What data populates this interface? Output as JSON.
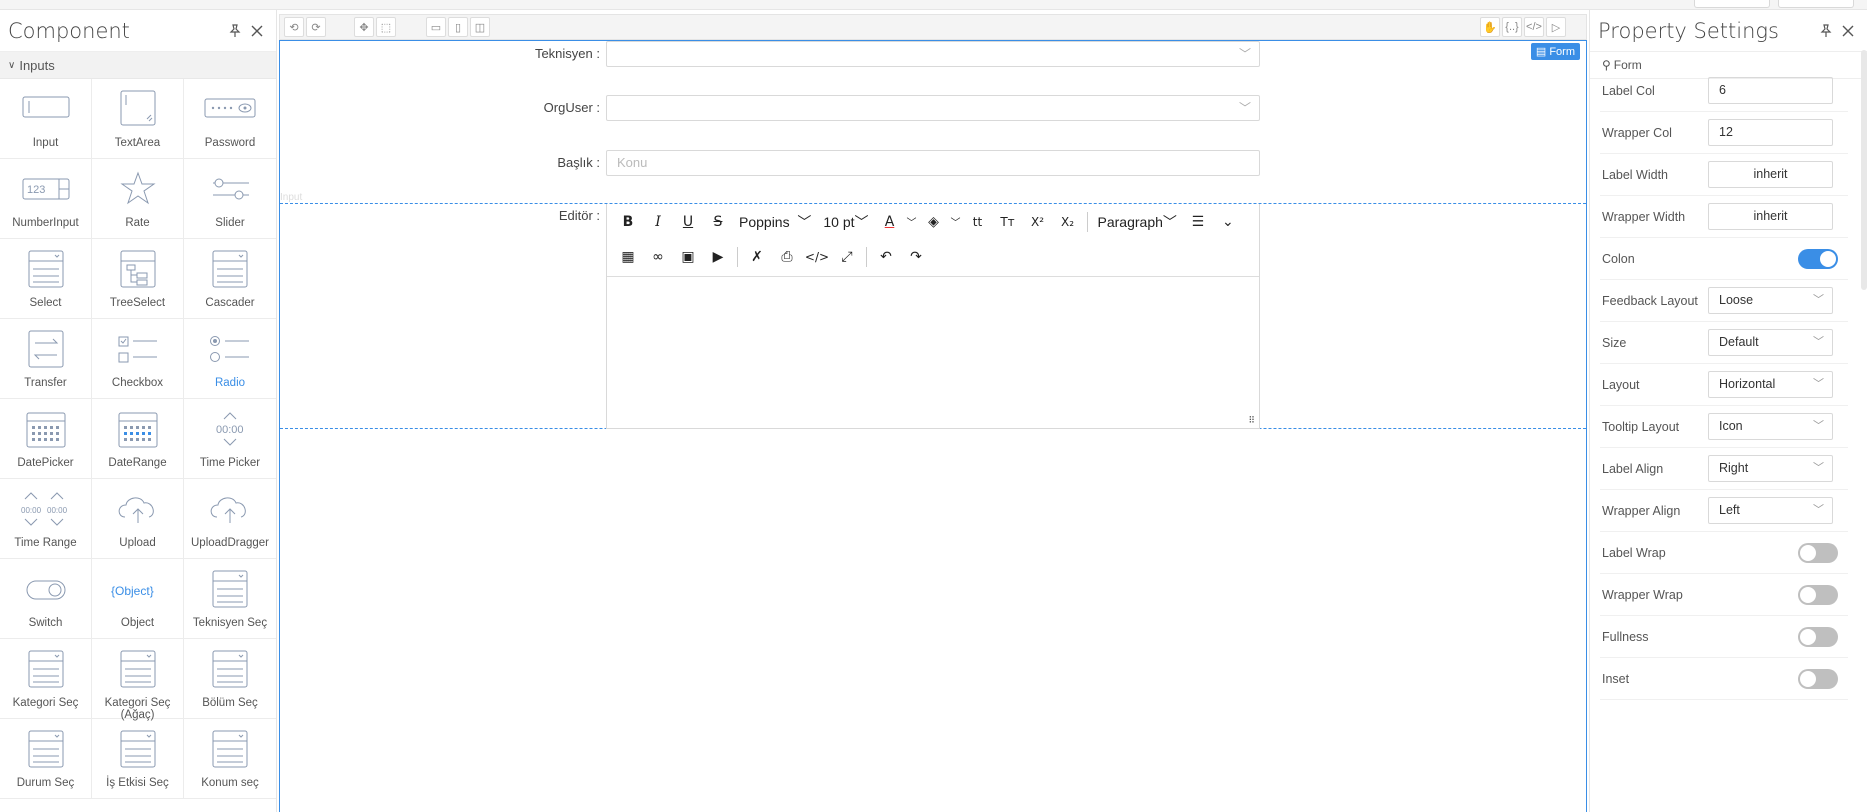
{
  "left_panel": {
    "title": "Component",
    "group": "Inputs",
    "items": [
      {
        "label": "Input",
        "icon": "input-icon"
      },
      {
        "label": "TextArea",
        "icon": "textarea-icon"
      },
      {
        "label": "Password",
        "icon": "password-icon"
      },
      {
        "label": "NumberInput",
        "icon": "number-input-icon",
        "glyph": "123"
      },
      {
        "label": "Rate",
        "icon": "star-icon"
      },
      {
        "label": "Slider",
        "icon": "slider-icon"
      },
      {
        "label": "Select",
        "icon": "select-icon"
      },
      {
        "label": "TreeSelect",
        "icon": "tree-select-icon"
      },
      {
        "label": "Cascader",
        "icon": "cascader-icon"
      },
      {
        "label": "Transfer",
        "icon": "transfer-icon"
      },
      {
        "label": "Checkbox",
        "icon": "checkbox-icon"
      },
      {
        "label": "Radio",
        "icon": "radio-icon"
      },
      {
        "label": "DatePicker",
        "icon": "calendar-icon"
      },
      {
        "label": "DateRange",
        "icon": "date-range-icon"
      },
      {
        "label": "Time Picker",
        "icon": "time-picker-icon",
        "glyph": "00:00"
      },
      {
        "label": "Time Range",
        "icon": "time-range-icon",
        "glyph": "00:00"
      },
      {
        "label": "Upload",
        "icon": "upload-icon"
      },
      {
        "label": "UploadDragger",
        "icon": "upload-dragger-icon"
      },
      {
        "label": "Switch",
        "icon": "switch-icon"
      },
      {
        "label": "Object",
        "icon": "object-icon",
        "glyph": "{Object}"
      },
      {
        "label": "Teknisyen Seç",
        "icon": "select-icon"
      },
      {
        "label": "Kategori Seç",
        "icon": "select-icon"
      },
      {
        "label": "Kategori Seç (Ağaç)",
        "icon": "select-icon"
      },
      {
        "label": "Bölüm Seç",
        "icon": "select-icon"
      },
      {
        "label": "Durum Seç",
        "icon": "select-icon"
      },
      {
        "label": "İş Etkisi Seç",
        "icon": "select-icon"
      },
      {
        "label": "Konum seç",
        "icon": "select-icon"
      }
    ]
  },
  "canvas": {
    "badge": "Form",
    "ghost_label": "Input",
    "fields": {
      "teknisyen": {
        "label": "Teknisyen :",
        "value": ""
      },
      "orguser": {
        "label": "OrgUser :",
        "value": ""
      },
      "baslik": {
        "label": "Başlık :",
        "placeholder": "Konu"
      },
      "editor": {
        "label": "Editör :"
      }
    },
    "editor_toolbar": {
      "font": "Poppins",
      "size": "10 pt",
      "block": "Paragraph"
    }
  },
  "right_panel": {
    "title": "Property Settings",
    "breadcrumb": "Form",
    "props": {
      "label_col": {
        "label": "Label Col",
        "value": "6"
      },
      "wrapper_col": {
        "label": "Wrapper Col",
        "value": "12"
      },
      "label_width": {
        "label": "Label Width",
        "value": "inherit"
      },
      "wrapper_width": {
        "label": "Wrapper Width",
        "value": "inherit"
      },
      "colon": {
        "label": "Colon",
        "on": true
      },
      "feedback_layout": {
        "label": "Feedback Layout",
        "value": "Loose"
      },
      "size": {
        "label": "Size",
        "value": "Default"
      },
      "layout": {
        "label": "Layout",
        "value": "Horizontal"
      },
      "tooltip_layout": {
        "label": "Tooltip Layout",
        "value": "Icon"
      },
      "label_align": {
        "label": "Label Align",
        "value": "Right"
      },
      "wrapper_align": {
        "label": "Wrapper Align",
        "value": "Left"
      },
      "label_wrap": {
        "label": "Label Wrap",
        "on": false
      },
      "wrapper_wrap": {
        "label": "Wrapper Wrap",
        "on": false
      },
      "fullness": {
        "label": "Fullness",
        "on": false
      },
      "inset": {
        "label": "Inset",
        "on": false
      }
    }
  },
  "colors": {
    "accent": "#3a8ee6",
    "border": "#d9d9d9"
  }
}
